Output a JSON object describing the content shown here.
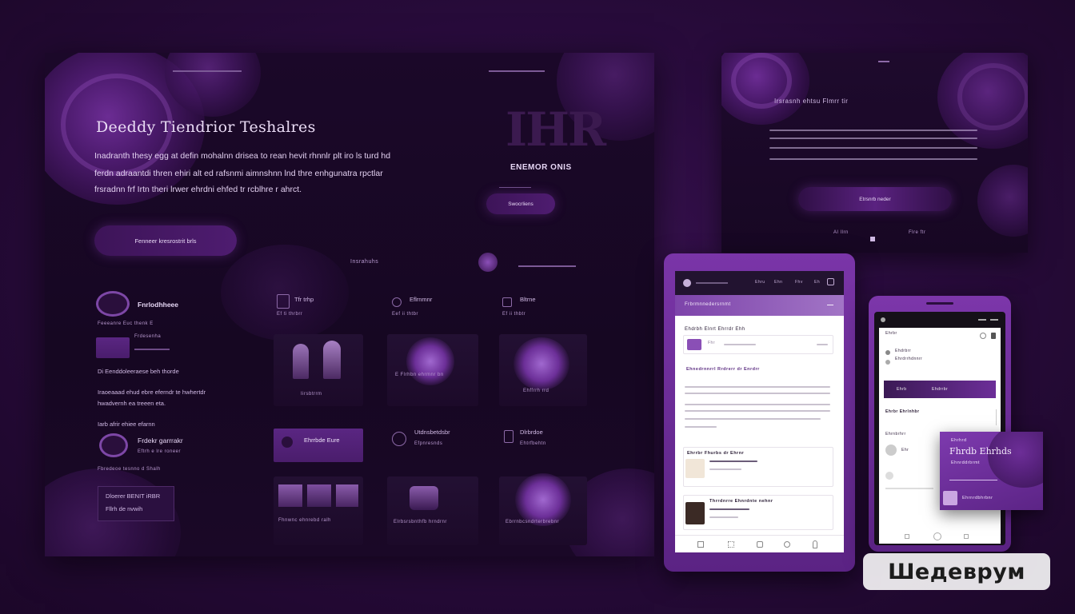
{
  "desktop": {
    "nav_left": "",
    "nav_right": "",
    "hero": {
      "title": "Deeddy Tiendrior Teshalres",
      "paragraph_lines": [
        "Inadranth thesy egg at defin mohalnn drisea to rean hevit rhnnlr plt iro ls  turd hd ",
        "ferdn adraantdi thren ehiri alt ed rafsnmi aimnshnn lnd thre enhgunatra rpctlar",
        "frsradnn frf Irtn theri lrwer ehrdni ehfed tr rcblhre r ahrct."
      ],
      "cta_label": "Fenneer kresrostrit brls"
    },
    "brand": {
      "logo_text": "IHR",
      "subtitle": "ENEMOR ONIS",
      "button_label": "Swocrliens"
    },
    "section_label": "Insrahuhs",
    "profile": {
      "name": "Fnrlodhheee",
      "handle": "Feeeanre Euc thenk E",
      "badge_text": "Frdesenha",
      "line1": "Di  Eenddoleeraese beh thorde",
      "line2": "Iraoeaaad ehud ebre eferndr te hwhertdr",
      "line3": "hwadvernh ea treeen eta.",
      "subhead": "Iarb afrir ehiee efarnn",
      "item_title": "Frdekr garrrakr",
      "item_sub": "Eftrh e lre roneer",
      "footer_note": "Fbredeoe tesnno d Shalh",
      "box_line1": "Dloerer  BENIT iRBR",
      "box_line2": "Fllrh de nvwih"
    },
    "cards_row1": [
      {
        "title": "Tfr trhp",
        "sub": "Ef ti thrbrr"
      },
      {
        "title": "Eflrnmnr",
        "sub": "Eef ii thtbr"
      },
      {
        "title": "Bltrne",
        "sub": "Ef ii thbtr"
      }
    ],
    "cards_row2": [
      {
        "caption": "Iirsbtrrm"
      },
      {
        "caption": "E   Flrhbn ehrmnr bn"
      },
      {
        "caption": "Ehffrrh rrd"
      }
    ],
    "cards_row3": [
      {
        "title": "Ehrrbde Eure",
        "sub": ""
      },
      {
        "title": "Utdnsbetdsbr",
        "sub": "Efpnresnds"
      },
      {
        "title": "Dlrbrdoe",
        "sub": "Ehtrfbehtn"
      }
    ],
    "cards_row4": [
      {
        "caption": "Fhnwnc ehnrebd ralh"
      },
      {
        "caption": "Elrbsrsbnthfb hrndrnr"
      },
      {
        "caption": "Ebrrnbcsndrterbrebnr"
      }
    ]
  },
  "screen2": {
    "title": "Irsrasnh ehtsu Flmrr tir",
    "button_label": "Etrsnrb neder",
    "footer_left": "Al Ilrn",
    "footer_right": "Flre ftr"
  },
  "tablet": {
    "nav_items": [
      "Ehru",
      "Ehn",
      "Fhv",
      "Eh"
    ],
    "banner": "Frbrmnnedersrnmt",
    "card1_title": "Ehdrbh  Elnrt Ehrrdr Ehh",
    "card1_meta": "Fhr",
    "section_title": "Ehnedrnnrrl  Rrdrerr  dr Enrdrr",
    "item1_title": "Ehrrbr Fhurbs dr Ehrnr",
    "item2_title": "Thrrdnrre Ehnrdnte nehnr",
    "footer_icons": [
      "home-icon",
      "grid-icon",
      "chat-icon",
      "globe-icon",
      "user-icon"
    ]
  },
  "phone": {
    "header": "Ehrbr",
    "row1": "Ehdrbrr",
    "row2": "Ehrdrrhdnnrr",
    "button_left": "Ehrb",
    "button_right": "Ehdrrbr",
    "section": "Ehrbr Ehrlnhbr",
    "list_title": "Ehrnbrhrr",
    "list_item": "Ehr"
  },
  "float_card": {
    "kicker": "Ehrhrd",
    "title": "Fhrdb Ehrhds",
    "sub": "Ehnrddrbrmt",
    "foot": "Ehrnrdbhrbnr"
  },
  "watermark": "Шедеврум"
}
